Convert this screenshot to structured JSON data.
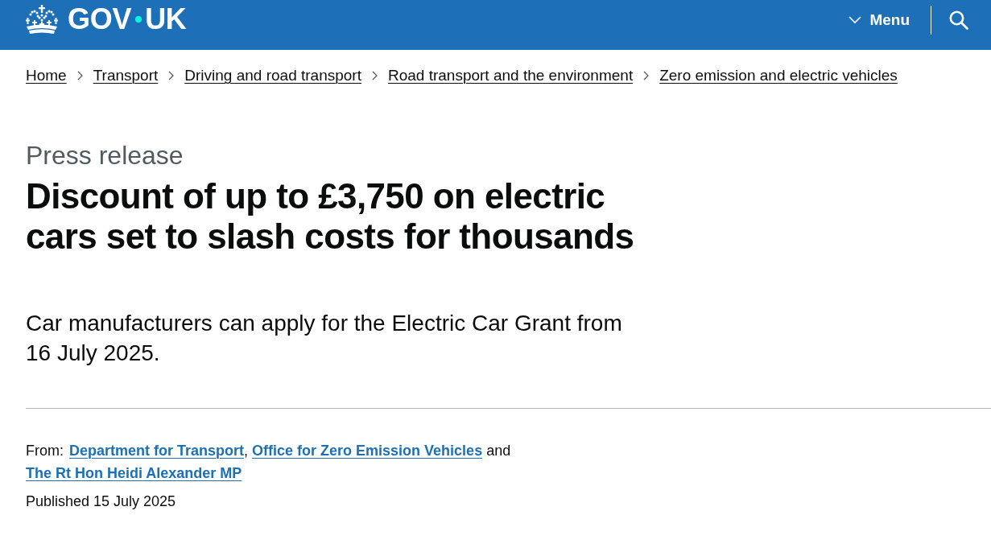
{
  "header": {
    "logo": {
      "words": [
        "GOV",
        "UK"
      ]
    },
    "menu_button": {
      "label": "Menu",
      "expanded": false
    }
  },
  "breadcrumbs": [
    {
      "label": "Home"
    },
    {
      "label": "Transport"
    },
    {
      "label": "Driving and road transport"
    },
    {
      "label": "Road transport and the environment"
    },
    {
      "label": "Zero emission and electric vehicles"
    }
  ],
  "document_type": "Press release",
  "title": "Discount of up to £3,750 on electric cars set to slash costs for thousands",
  "summary": "Car manufacturers can apply for the Electric Car Grant from 16 July 2025.",
  "metadata": {
    "from": {
      "label": "From:",
      "parts": [
        {
          "kind": "link",
          "text": "Department for Transport"
        },
        {
          "kind": "text",
          "text": ", "
        },
        {
          "kind": "link",
          "text": "Office for Zero Emission Vehicles"
        },
        {
          "kind": "text",
          "text": " and "
        },
        {
          "kind": "link",
          "text": "The Rt Hon Heidi Alexander MP"
        }
      ]
    },
    "published": "Published 15 July 2025"
  }
}
